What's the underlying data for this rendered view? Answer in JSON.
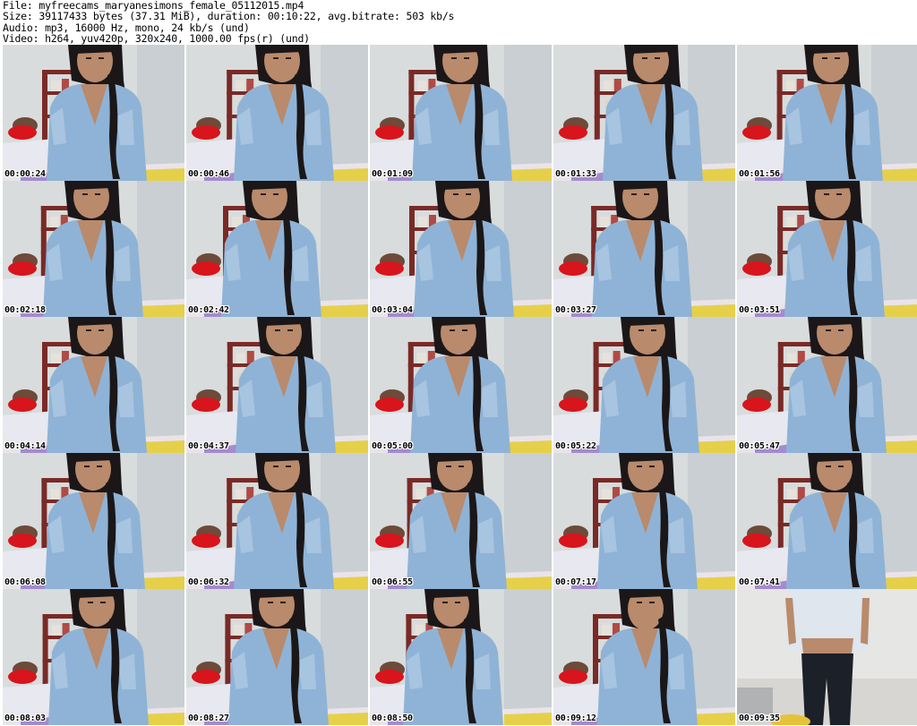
{
  "header": {
    "file_line": "File: myfreecams_maryanesimons_female_05112015.mp4",
    "size_line": "Size: 39117433 bytes (37.31 MiB), duration: 00:10:22, avg.bitrate: 503 kb/s",
    "audio_line": "Audio: mp3, 16000 Hz, mono, 24 kb/s (und)",
    "video_line": "Video: h264, yuv420p, 320x240, 1000.00 fps(r) (und)"
  },
  "frames": [
    {
      "timestamp": "00:00:24"
    },
    {
      "timestamp": "00:00:46"
    },
    {
      "timestamp": "00:01:09"
    },
    {
      "timestamp": "00:01:33"
    },
    {
      "timestamp": "00:01:56"
    },
    {
      "timestamp": "00:02:18"
    },
    {
      "timestamp": "00:02:42"
    },
    {
      "timestamp": "00:03:04"
    },
    {
      "timestamp": "00:03:27"
    },
    {
      "timestamp": "00:03:51"
    },
    {
      "timestamp": "00:04:14"
    },
    {
      "timestamp": "00:04:37"
    },
    {
      "timestamp": "00:05:00"
    },
    {
      "timestamp": "00:05:22"
    },
    {
      "timestamp": "00:05:47"
    },
    {
      "timestamp": "00:06:08"
    },
    {
      "timestamp": "00:06:32"
    },
    {
      "timestamp": "00:06:55"
    },
    {
      "timestamp": "00:07:17"
    },
    {
      "timestamp": "00:07:41"
    },
    {
      "timestamp": "00:08:03"
    },
    {
      "timestamp": "00:08:27"
    },
    {
      "timestamp": "00:08:50"
    },
    {
      "timestamp": "00:09:12"
    },
    {
      "timestamp": "00:09:35"
    }
  ],
  "colors": {
    "wall": "#d8dcdc",
    "shelf": "#7a2a26",
    "shirt": "#8fb3d6",
    "hair": "#1b1718",
    "skin": "#b98a6c",
    "pillow_red": "#d8141c",
    "bed": "#e8e8f0",
    "jeans": "#1c2028"
  }
}
